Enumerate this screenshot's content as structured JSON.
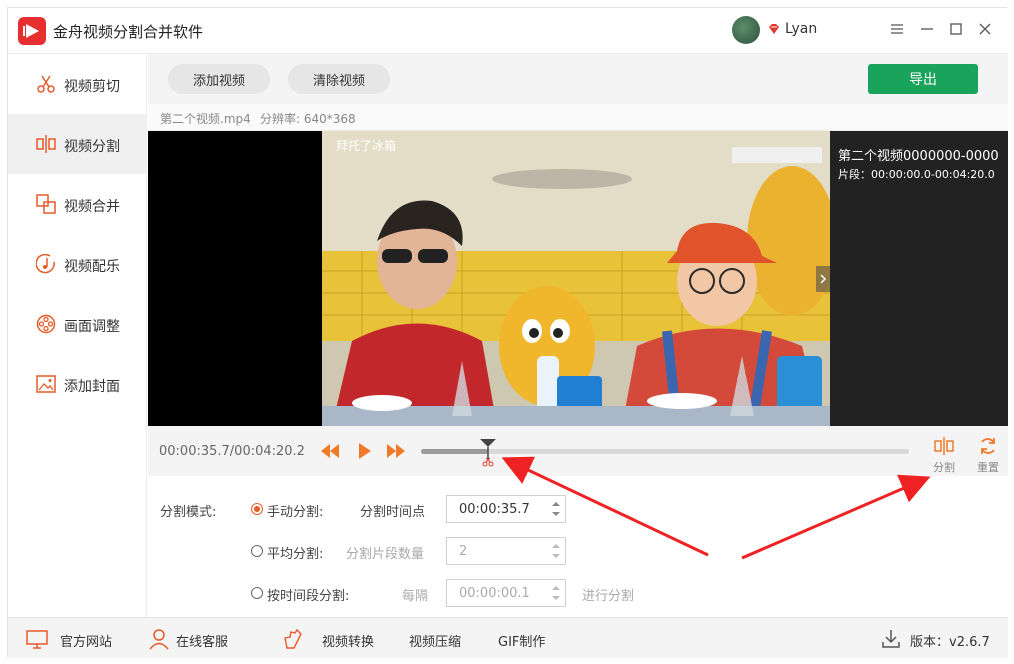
{
  "app": {
    "title": "金舟视频分割合并软件",
    "username": "Lyan"
  },
  "colors": {
    "accent": "#e65a2a",
    "export": "#1aa35a",
    "annotation": "#ee2222"
  },
  "sidebar": {
    "items": [
      {
        "label": "视频剪切",
        "icon": "scissors-icon",
        "active": false
      },
      {
        "label": "视频分割",
        "icon": "split-icon",
        "active": true
      },
      {
        "label": "视频合并",
        "icon": "merge-icon",
        "active": false
      },
      {
        "label": "视频配乐",
        "icon": "music-icon",
        "active": false
      },
      {
        "label": "画面调整",
        "icon": "film-reel-icon",
        "active": false
      },
      {
        "label": "添加封面",
        "icon": "image-icon",
        "active": false
      }
    ]
  },
  "toolbar": {
    "add_video": "添加视频",
    "clear_video": "清除视频",
    "export": "导出"
  },
  "file": {
    "name": "第二个视频.mp4",
    "resolution": "分辨率: 640*368"
  },
  "video": {
    "overlay_text": "拜托了冰箱",
    "segment_title": "第二个视频0000000-0000",
    "segment_range": "片段：00:00:00.0-00:04:20.0"
  },
  "player": {
    "time": "00:00:35.7/00:04:20.2",
    "progress": 0.137,
    "split_label": "分割",
    "reset_label": "重置"
  },
  "split": {
    "mode_label": "分割模式:",
    "manual": {
      "label": "手动分割:",
      "field_label": "分割时间点",
      "value": "00:00:35.7",
      "selected": true
    },
    "average": {
      "label": "平均分割:",
      "field_label": "分割片段数量",
      "value": "2",
      "selected": false
    },
    "by_time": {
      "label": "按时间段分割:",
      "field_label": "每隔",
      "value": "00:00:00.1",
      "suffix": "进行分割",
      "selected": false
    }
  },
  "footer": {
    "website": "官方网站",
    "support": "在线客服",
    "convert": "视频转换",
    "compress": "视频压缩",
    "gif": "GIF制作",
    "version": "版本：v2.6.7"
  }
}
